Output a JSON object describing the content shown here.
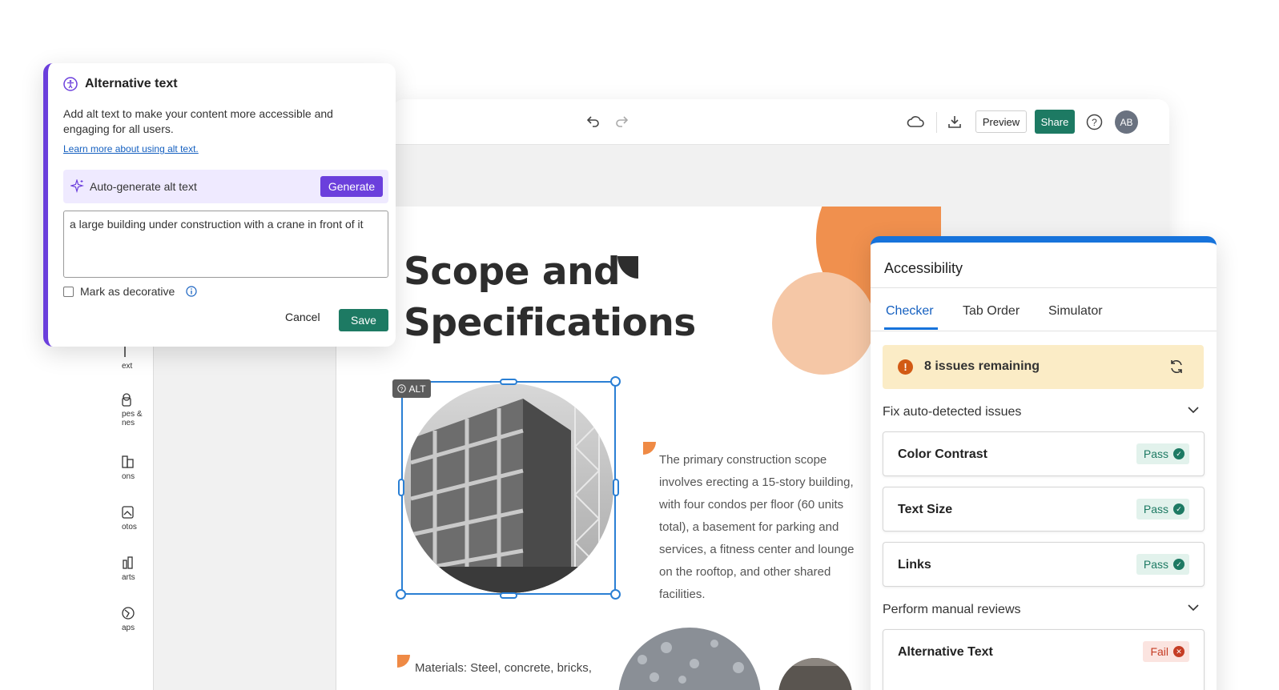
{
  "toolbar": {
    "preview_label": "Preview",
    "share_label": "Share",
    "avatar_initials": "AB",
    "icons": [
      "undo-icon",
      "redo-icon",
      "cloud-sync-icon",
      "download-icon",
      "help-icon"
    ],
    "accent_color": "#1d7a63"
  },
  "left_rail": {
    "items": [
      {
        "label": "ext",
        "icon": "text-icon"
      },
      {
        "label": "pes & nes",
        "icon": "shapes-icon"
      },
      {
        "label": "ons",
        "icon": "icons-icon"
      },
      {
        "label": "otos",
        "icon": "photos-icon"
      },
      {
        "label": "arts",
        "icon": "charts-icon"
      },
      {
        "label": "aps",
        "icon": "maps-icon"
      }
    ]
  },
  "slide": {
    "title_line1": "Scope and",
    "title_line2": "Specifications",
    "body": "The primary construction scope involves erecting a 15-story building, with four condos per floor (60 units total), a basement for parking and services, a fitness center and lounge on the rooftop, and other shared facilities.",
    "materials": "Materials: Steel, concrete, bricks,",
    "alt_chip": "ALT",
    "accent_color": "#ef8a45"
  },
  "alt_dialog": {
    "title": "Alternative text",
    "description": "Add alt text to make your content more accessible and engaging for all users.",
    "learn_more": "Learn more about using alt text.",
    "auto_generate_label": "Auto-generate alt text",
    "generate_button": "Generate",
    "alt_text_value": "a large building under construction with a crane in front of it",
    "decorative_label": "Mark as decorative",
    "decorative_checked": false,
    "cancel_label": "Cancel",
    "save_label": "Save",
    "accent_color": "#6b3fdc"
  },
  "accessibility": {
    "title": "Accessibility",
    "tabs": [
      {
        "label": "Checker",
        "active": true
      },
      {
        "label": "Tab Order",
        "active": false
      },
      {
        "label": "Simulator",
        "active": false
      }
    ],
    "issues_remaining": "8 issues remaining",
    "auto_section": "Fix auto-detected issues",
    "auto_checks": [
      {
        "label": "Color Contrast",
        "status": "Pass"
      },
      {
        "label": "Text Size",
        "status": "Pass"
      },
      {
        "label": "Links",
        "status": "Pass"
      }
    ],
    "manual_section": "Perform manual reviews",
    "manual_checks": [
      {
        "label": "Alternative Text",
        "status": "Fail"
      }
    ],
    "accent_color": "#1773db"
  }
}
